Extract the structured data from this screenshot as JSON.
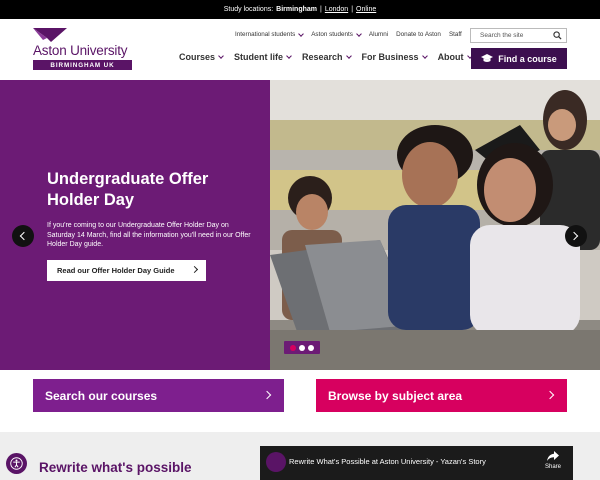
{
  "topbar": {
    "prefix": "Study locations:",
    "loc1": "Birmingham",
    "sep1": "|",
    "loc2": "London",
    "sep2": "|",
    "loc3": "Online"
  },
  "logo": {
    "name": "Aston University",
    "sub": "BIRMINGHAM UK"
  },
  "utility": {
    "international": "International students",
    "aston_students": "Aston students",
    "alumni": "Alumni",
    "donate": "Donate to Aston",
    "staff": "Staff"
  },
  "search": {
    "placeholder": "Search the site"
  },
  "nav": {
    "courses": "Courses",
    "student_life": "Student life",
    "research": "Research",
    "business": "For Business",
    "about": "About"
  },
  "find_course": "Find a course",
  "hero": {
    "title": "Undergraduate Offer Holder Day",
    "text": "If you're coming to our Undergraduate Offer Holder Day on Saturday 14 March, find all the information you'll need in our Offer Holder Day guide.",
    "button": "Read our Offer Holder Day Guide",
    "active_slide": 1,
    "slide_count": 3
  },
  "cta": {
    "courses": "Search our courses",
    "subject": "Browse by subject area"
  },
  "lower": {
    "heading": "Rewrite what's possible",
    "video_title": "Rewrite What's Possible at Aston University - Yazan's Story",
    "share": "Share"
  },
  "colors": {
    "brand_purple": "#5a1466",
    "hero_purple": "#6c1b75",
    "cta_purple": "#7e1f8e",
    "cta_pink": "#d7005f",
    "find_course_bg": "#3c0f4f"
  }
}
